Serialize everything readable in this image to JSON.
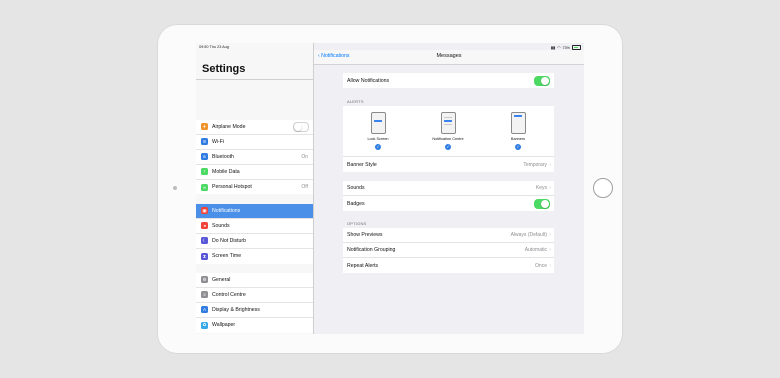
{
  "status": {
    "time": "09:50   Thu 23 Aug",
    "battery": "73%"
  },
  "sidebar": {
    "title": "Settings",
    "group1": [
      {
        "label": "Airplane Mode",
        "icon_color": "#f0932b",
        "toggle": false
      },
      {
        "label": "Wi-Fi",
        "icon_color": "#2f7de1"
      },
      {
        "label": "Bluetooth",
        "icon_color": "#2f7de1",
        "value": "On"
      },
      {
        "label": "Mobile Data",
        "icon_color": "#4cd964"
      },
      {
        "label": "Personal Hotspot",
        "icon_color": "#4cd964",
        "value": "Off"
      }
    ],
    "group2": [
      {
        "label": "Notifications",
        "icon_color": "#f0433a",
        "selected": true
      },
      {
        "label": "Sounds",
        "icon_color": "#f0433a"
      },
      {
        "label": "Do Not Disturb",
        "icon_color": "#5856d6"
      },
      {
        "label": "Screen Time",
        "icon_color": "#5856d6"
      }
    ],
    "group3": [
      {
        "label": "General",
        "icon_color": "#8e8e93"
      },
      {
        "label": "Control Centre",
        "icon_color": "#8e8e93"
      },
      {
        "label": "Display & Brightness",
        "icon_color": "#2f7de1"
      },
      {
        "label": "Wallpaper",
        "icon_color": "#38a9e8"
      }
    ]
  },
  "detail": {
    "back_label": "Notifications",
    "title": "Messages",
    "allow_notifications": {
      "label": "Allow Notifications",
      "on": true
    },
    "alerts_header": "ALERTS",
    "alert_options": [
      "Lock Screen",
      "Notification Centre",
      "Banners"
    ],
    "banner_style": {
      "label": "Banner Style",
      "value": "Temporary"
    },
    "sounds": {
      "label": "Sounds",
      "value": "Keys"
    },
    "badges": {
      "label": "Badges",
      "on": true
    },
    "options_header": "OPTIONS",
    "show_previews": {
      "label": "Show Previews",
      "value": "Always (Default)"
    },
    "grouping": {
      "label": "Notification Grouping",
      "value": "Automatic"
    },
    "repeat_alerts": {
      "label": "Repeat Alerts",
      "value": "Once"
    }
  }
}
